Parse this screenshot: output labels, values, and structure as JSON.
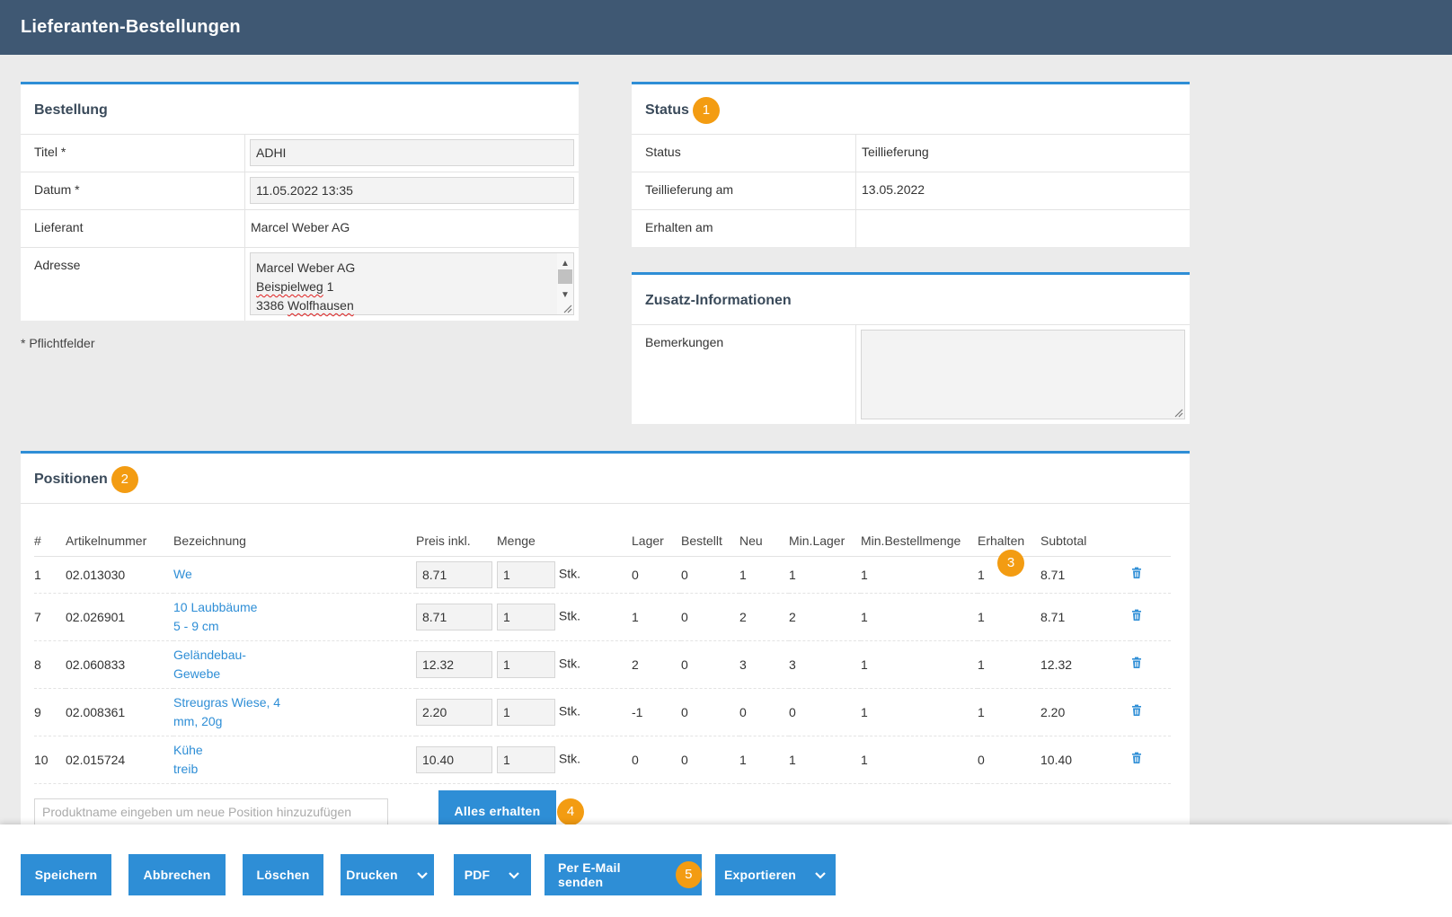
{
  "header": {
    "title": "Lieferanten-Bestellungen"
  },
  "bestellung": {
    "title": "Bestellung",
    "titel_label": "Titel *",
    "titel_value": "ADHI",
    "datum_label": "Datum *",
    "datum_value": "11.05.2022 13:35",
    "lieferant_label": "Lieferant",
    "lieferant_value": "Marcel Weber AG",
    "adresse_label": "Adresse",
    "adresse_line1": "Marcel Weber AG",
    "adresse_line2a": "Beispielweg",
    "adresse_line2b": " 1",
    "adresse_line3a": "3386 ",
    "adresse_line3b": "Wolfhausen"
  },
  "pflicht_hint": "* Pflichtfelder",
  "status": {
    "title": "Status",
    "badge": "1",
    "status_label": "Status",
    "status_value": "Teillieferung",
    "teil_label": "Teillieferung am",
    "teil_value": "13.05.2022",
    "erhalten_label": "Erhalten am",
    "erhalten_value": ""
  },
  "zusatz": {
    "title": "Zusatz-Informationen",
    "bemerkungen_label": "Bemerkungen",
    "bemerkungen_value": ""
  },
  "positionen": {
    "title": "Positionen",
    "badge": "2",
    "columns": [
      "#",
      "Artikelnummer",
      "Bezeichnung",
      "Preis inkl.",
      "Menge",
      "Lager",
      "Bestellt",
      "Neu",
      "Min.Lager",
      "Min.Bestellmenge",
      "Erhalten",
      "Subtotal"
    ],
    "erhalten_badge": "3",
    "unit": "Stk.",
    "rows": [
      {
        "nr": "1",
        "artikel": "02.013030",
        "bez1": "We",
        "bez2": "",
        "preis": "8.71",
        "menge": "1",
        "lager": "0",
        "bestellt": "0",
        "neu": "1",
        "minlager": "1",
        "minbest": "1",
        "erhalten": "1",
        "subtotal": "8.71"
      },
      {
        "nr": "7",
        "artikel": "02.026901",
        "bez1": "10 Laubbäume",
        "bez2": "5 - 9 cm",
        "preis": "8.71",
        "menge": "1",
        "lager": "1",
        "bestellt": "0",
        "neu": "2",
        "minlager": "2",
        "minbest": "1",
        "erhalten": "1",
        "subtotal": "8.71"
      },
      {
        "nr": "8",
        "artikel": "02.060833",
        "bez1": "Geländebau-",
        "bez2": "Gewebe",
        "preis": "12.32",
        "menge": "1",
        "lager": "2",
        "bestellt": "0",
        "neu": "3",
        "minlager": "3",
        "minbest": "1",
        "erhalten": "1",
        "subtotal": "12.32"
      },
      {
        "nr": "9",
        "artikel": "02.008361",
        "bez1": "Streugras Wiese, 4",
        "bez2": "mm, 20g",
        "preis": "2.20",
        "menge": "1",
        "lager": "-1",
        "bestellt": "0",
        "neu": "0",
        "minlager": "0",
        "minbest": "1",
        "erhalten": "1",
        "subtotal": "2.20"
      },
      {
        "nr": "10",
        "artikel": "02.015724",
        "bez1": "Kühe",
        "bez2": "treib",
        "preis": "10.40",
        "menge": "1",
        "lager": "0",
        "bestellt": "0",
        "neu": "1",
        "minlager": "1",
        "minbest": "1",
        "erhalten": "0",
        "subtotal": "10.40"
      }
    ],
    "new_placeholder": "Produktname eingeben um neue Position hinzuzufügen",
    "alles_erhalten": "Alles erhalten",
    "alles_badge": "4"
  },
  "footer": {
    "speichern": "Speichern",
    "abbrechen": "Abbrechen",
    "loeschen": "Löschen",
    "drucken": "Drucken",
    "pdf": "PDF",
    "email": "Per E-Mail senden",
    "email_badge": "5",
    "exportieren": "Exportieren"
  },
  "colors": {
    "header": "#3f5873",
    "accent": "#2e8ed6",
    "badge": "#f39c12",
    "background": "#ebebeb"
  },
  "icons": {
    "delete": "trash-icon",
    "dropdown": "chevron-down-icon"
  }
}
